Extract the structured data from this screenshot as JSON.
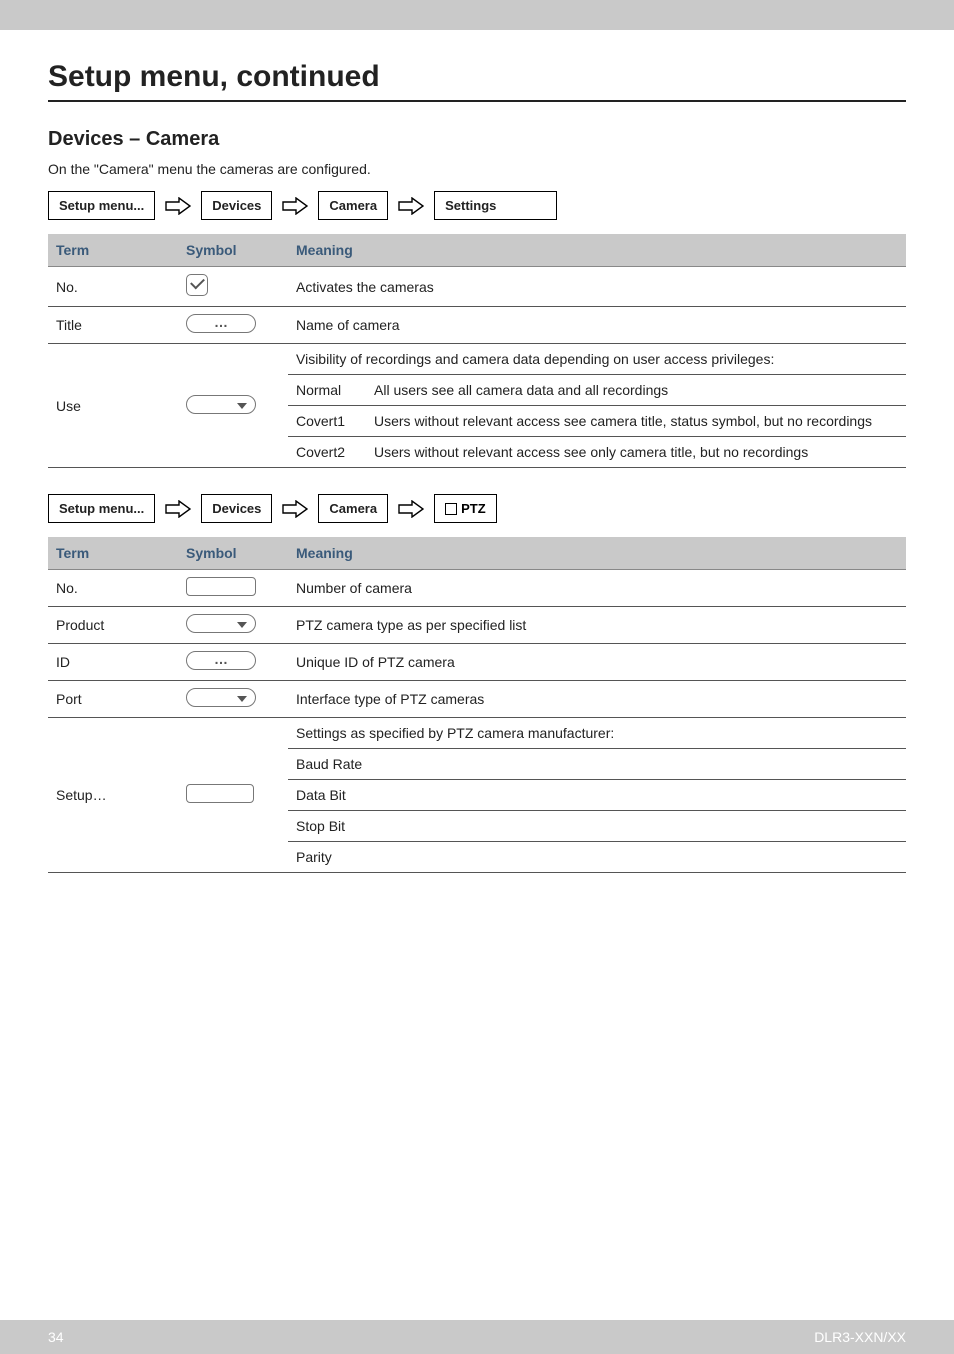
{
  "page": {
    "title": "Setup menu, continued",
    "section_title": "Devices – Camera",
    "intro": "On the \"Camera\" menu the cameras are configured."
  },
  "breadcrumb1": {
    "item1": "Setup menu...",
    "item2": "Devices",
    "item3": "Camera",
    "item4": "Settings"
  },
  "breadcrumb2": {
    "item1": "Setup menu...",
    "item2": "Devices",
    "item3": "Camera",
    "item4": "PTZ"
  },
  "table1": {
    "headers": {
      "term": "Term",
      "symbol": "Symbol",
      "meaning": "Meaning"
    },
    "rows": {
      "no": {
        "term": "No.",
        "meaning": "Activates the cameras"
      },
      "title": {
        "term": "Title",
        "meaning": "Name of camera"
      },
      "use": {
        "term": "Use",
        "intro": "Visibility of recordings and camera data depending on user access privileges:",
        "normal_label": "Normal",
        "normal_desc": "All users see all camera data and all recordings",
        "covert1_label": "Covert1",
        "covert1_desc": "Users without relevant access see camera title, status symbol, but no recordings",
        "covert2_label": "Covert2",
        "covert2_desc": "Users without relevant access see only camera title, but no recordings"
      }
    }
  },
  "table2": {
    "headers": {
      "term": "Term",
      "symbol": "Symbol",
      "meaning": "Meaning"
    },
    "rows": {
      "no": {
        "term": "No.",
        "meaning": "Number of camera"
      },
      "product": {
        "term": "Product",
        "meaning": "PTZ camera type as per specified list"
      },
      "id": {
        "term": "ID",
        "meaning": "Unique ID of PTZ camera"
      },
      "port": {
        "term": "Port",
        "meaning": "Interface type of PTZ cameras"
      },
      "setup": {
        "term": "Setup…",
        "intro": "Settings as specified by PTZ camera manufacturer:",
        "baud": "Baud Rate",
        "databit": "Data Bit",
        "stopbit": "Stop Bit",
        "parity": "Parity"
      }
    }
  },
  "footer": {
    "page": "34",
    "doc": "DLR3-XXN/XX"
  }
}
